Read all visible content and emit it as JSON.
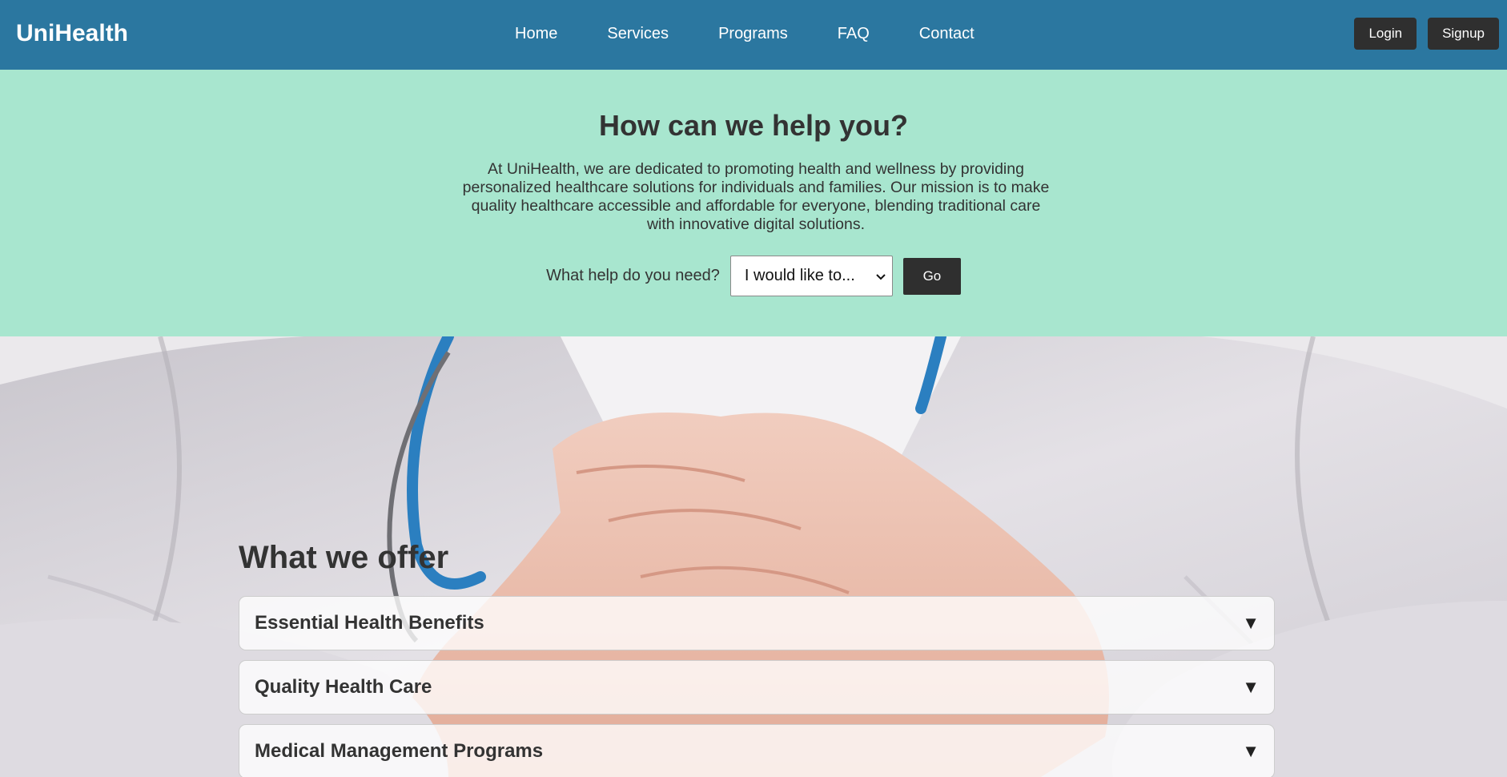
{
  "header": {
    "brand": "UniHealth",
    "nav": [
      "Home",
      "Services",
      "Programs",
      "FAQ",
      "Contact"
    ],
    "login_label": "Login",
    "signup_label": "Signup"
  },
  "help": {
    "title": "How can we help you?",
    "description": "At UniHealth, we are dedicated to promoting health and wellness by providing personalized healthcare solutions for individuals and families. Our mission is to make quality healthcare accessible and affordable for everyone, blending traditional care with innovative digital solutions.",
    "question_label": "What help do you need?",
    "select_value": "I would like to...",
    "go_label": "Go"
  },
  "offer": {
    "title": "What we offer",
    "items": [
      {
        "title": "Essential Health Benefits",
        "arrow": "▼"
      },
      {
        "title": "Quality Health Care",
        "arrow": "▼"
      },
      {
        "title": "Medical Management Programs",
        "arrow": "▼"
      }
    ]
  },
  "colors": {
    "header_bg": "#2b77a0",
    "help_bg": "#a8e6cf",
    "button_dark": "#2f2f2f",
    "text_dark": "#333333"
  }
}
